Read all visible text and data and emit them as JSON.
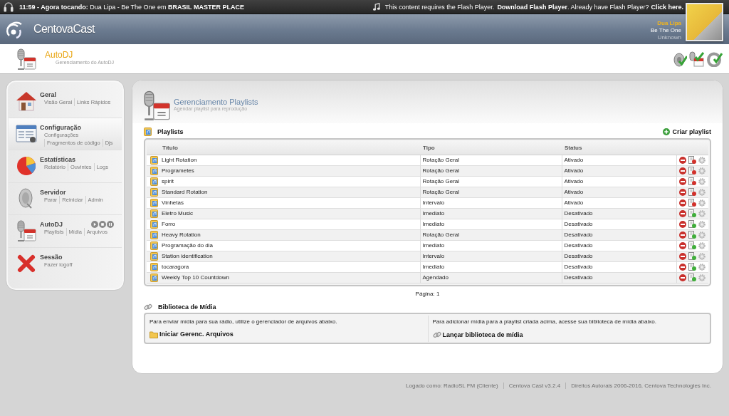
{
  "top_bar": {
    "now_playing": "**11:59 - Agora tocando:** Dua Lipa - Be The One em **BRASIL MASTER PLACE**",
    "flash_notice": [
      {
        "kind": "text",
        "text": "This content requires the Flash Player."
      },
      {
        "kind": "link",
        "text": "Download Flash Player"
      },
      {
        "kind": "text",
        "text": ". Already have Flash Player?"
      },
      {
        "kind": "link",
        "text": "Click here."
      }
    ]
  },
  "header": {
    "logo": "CentovaCast",
    "track": {
      "artist": "Dua Lipa",
      "title": "Be The One",
      "album": "Unknown"
    }
  },
  "page_header": {
    "title": "AutoDJ",
    "subtitle": "Gerenciamento do AutoDJ"
  },
  "sidebar": {
    "items": [
      {
        "title": "Geral",
        "selected": false,
        "links": [
          "Visão Geral",
          "Links Rápidos"
        ]
      },
      {
        "title": "Configuração",
        "selected": true,
        "links": [
          "Configurações",
          "Fragmentos de código",
          "Djs"
        ]
      },
      {
        "title": "Estatísticas",
        "selected": false,
        "links": [
          "Relatório",
          "Ouvintes",
          "Logs"
        ]
      },
      {
        "title": "Servidor",
        "selected": false,
        "links": [
          "Parar",
          "Reiniciar",
          "Admin"
        ]
      },
      {
        "title": "AutoDJ",
        "selected": false,
        "player_controls": true,
        "links": [
          "Playlists",
          "Mídia",
          "Arquivos"
        ]
      },
      {
        "title": "Sessão",
        "selected": false,
        "links": [
          "Fazer logoff"
        ]
      }
    ]
  },
  "main": {
    "title": "Gerenciamento Playlists",
    "subtitle": "Agendar playlist para reprodução",
    "playlists": {
      "heading": "Playlists",
      "create_button": "Criar playlist",
      "columns": [
        "Título",
        "Tipo",
        "Status"
      ],
      "rows": [
        {
          "title": "Light Rotation",
          "type": "Rotação Geral",
          "status": "Ativado",
          "enabled": true
        },
        {
          "title": "Programetes",
          "type": "Rotação Geral",
          "status": "Ativado",
          "enabled": true
        },
        {
          "title": "spirit",
          "type": "Rotação Geral",
          "status": "Ativado",
          "enabled": true
        },
        {
          "title": "Standard Rotation",
          "type": "Rotação Geral",
          "status": "Ativado",
          "enabled": true
        },
        {
          "title": "Vinhetas",
          "type": "Intervalo",
          "status": "Ativado",
          "enabled": true
        },
        {
          "title": "Eletro Music",
          "type": "Imediato",
          "status": "Desativado",
          "enabled": false
        },
        {
          "title": "Forro",
          "type": "Imediato",
          "status": "Desativado",
          "enabled": false
        },
        {
          "title": "Heavy Rotation",
          "type": "Rotação Geral",
          "status": "Desativado",
          "enabled": false
        },
        {
          "title": "Programação do dia",
          "type": "Imediato",
          "status": "Desativado",
          "enabled": false
        },
        {
          "title": "Station identification",
          "type": "Intervalo",
          "status": "Desativado",
          "enabled": false
        },
        {
          "title": "tocaragora",
          "type": "Imediato",
          "status": "Desativado",
          "enabled": false
        },
        {
          "title": "Weekly Top 10 Countdown",
          "type": "Agendado",
          "status": "Desativado",
          "enabled": false
        }
      ]
    },
    "pagination": "Página: 1",
    "media_library": {
      "heading": "Biblioteca de Mídia",
      "panels": [
        {
          "text": "Para enviar mídia para sua rádio, utilize o gerenciador de arquivos abaixo.",
          "link": "Iniciar Gerenc. Arquivos"
        },
        {
          "text": "Para adicionar mídia para a playlist criada acima, acesse sua biblioteca de mídia abaixo.",
          "link": "Lançar biblioteca de mídia"
        }
      ]
    }
  },
  "footer": [
    "Logado como: RadioSL FM (Cliente)",
    "Centova Cast v3.2.4",
    "Direitos Autorais 2006-2016, Centova Technologies Inc."
  ]
}
